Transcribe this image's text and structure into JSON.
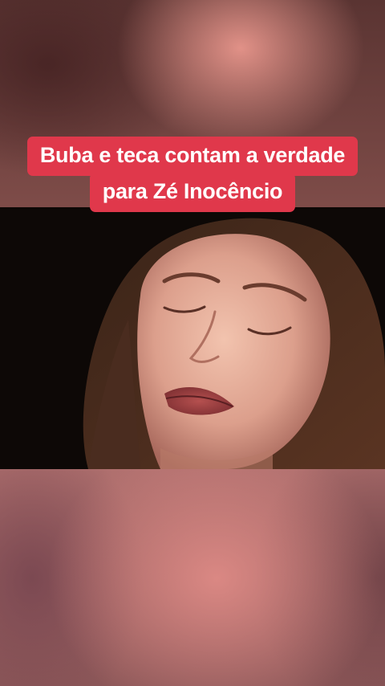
{
  "caption": {
    "line1": "Buba e teca contam a verdade",
    "line2": "para Zé Inocêncio",
    "background_color": "#e0384b",
    "text_color": "#ffffff"
  },
  "video": {
    "subject": "woman-face-closeup"
  }
}
